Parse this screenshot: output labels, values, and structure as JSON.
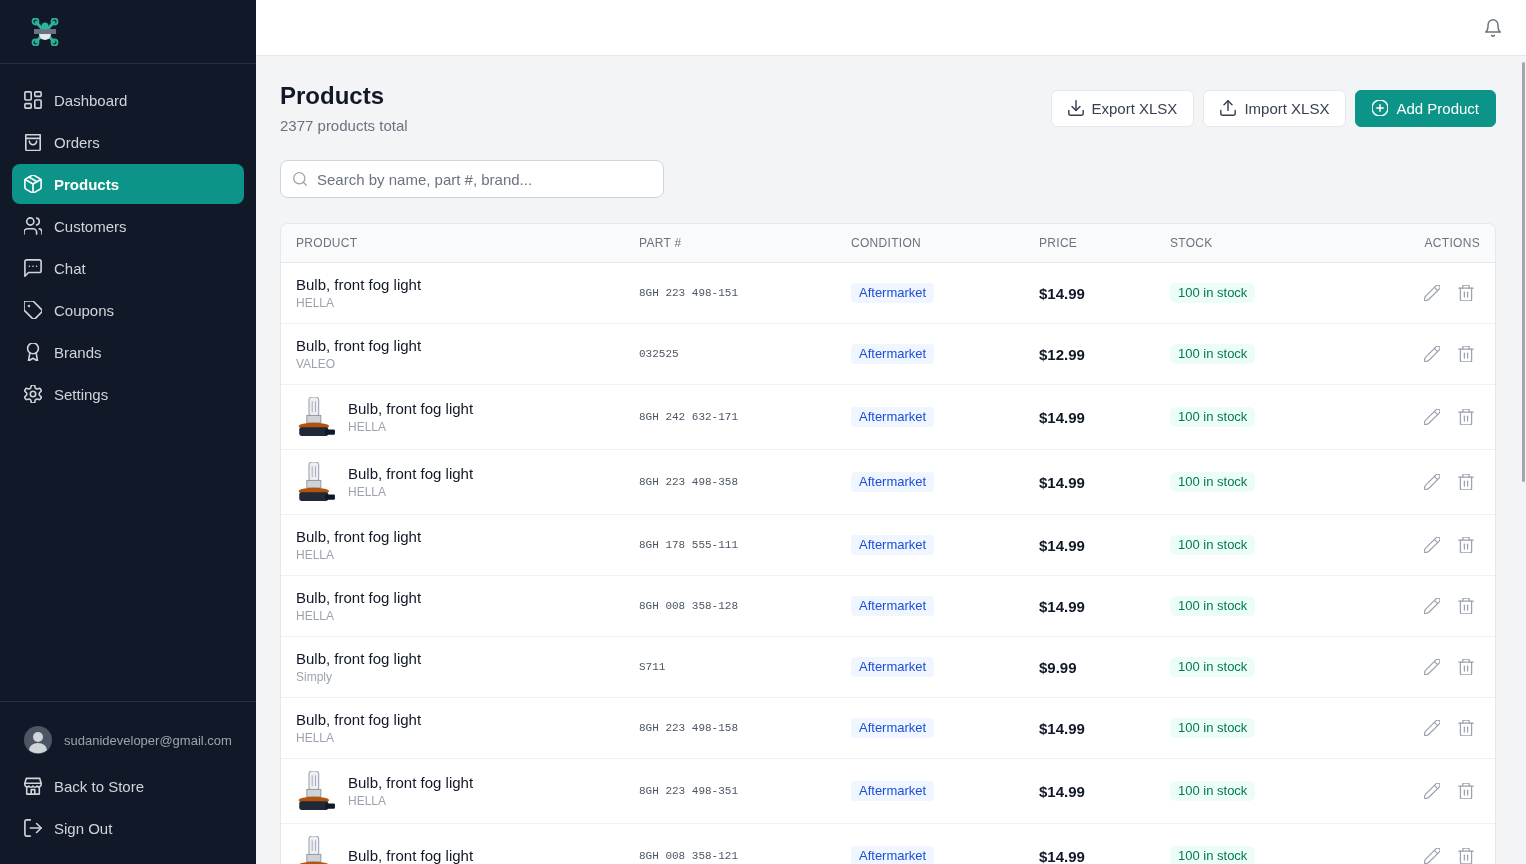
{
  "sidebar": {
    "nav": [
      {
        "label": "Dashboard",
        "selected": false
      },
      {
        "label": "Orders",
        "selected": false
      },
      {
        "label": "Products",
        "selected": true
      },
      {
        "label": "Customers",
        "selected": false
      },
      {
        "label": "Chat",
        "selected": false
      },
      {
        "label": "Coupons",
        "selected": false
      },
      {
        "label": "Brands",
        "selected": false
      },
      {
        "label": "Settings",
        "selected": false
      }
    ],
    "account": {
      "email": "sudanideveloper@gmail.com"
    },
    "links": [
      "Back to Store",
      "Sign Out"
    ]
  },
  "page": {
    "title": "Products",
    "subtitle": "2377 products total",
    "buttons": [
      {
        "label": "Export XLSX",
        "primary": false
      },
      {
        "label": "Import XLSX",
        "primary": false
      },
      {
        "label": "Add Product",
        "primary": true
      }
    ]
  },
  "search": {
    "placeholder": "Search by name, part #, brand..."
  },
  "table": {
    "columns": [
      "PRODUCT",
      "PART #",
      "CONDITION",
      "PRICE",
      "STOCK",
      "ACTIONS"
    ],
    "rows": [
      {
        "name": "Bulb, front fog light",
        "brand": "HELLA",
        "photo": false,
        "part_no": "8GH 223 498-151",
        "condition": "Aftermarket",
        "price": "$14.99",
        "stock": "100 in stock"
      },
      {
        "name": "Bulb, front fog light",
        "brand": "VALEO",
        "photo": false,
        "part_no": "032525",
        "condition": "Aftermarket",
        "price": "$12.99",
        "stock": "100 in stock"
      },
      {
        "name": "Bulb, front fog light",
        "brand": "HELLA",
        "photo": true,
        "part_no": "8GH 242 632-171",
        "condition": "Aftermarket",
        "price": "$14.99",
        "stock": "100 in stock"
      },
      {
        "name": "Bulb, front fog light",
        "brand": "HELLA",
        "photo": true,
        "part_no": "8GH 223 498-358",
        "condition": "Aftermarket",
        "price": "$14.99",
        "stock": "100 in stock"
      },
      {
        "name": "Bulb, front fog light",
        "brand": "HELLA",
        "photo": false,
        "part_no": "8GH 178 555-111",
        "condition": "Aftermarket",
        "price": "$14.99",
        "stock": "100 in stock"
      },
      {
        "name": "Bulb, front fog light",
        "brand": "HELLA",
        "photo": false,
        "part_no": "8GH 008 358-128",
        "condition": "Aftermarket",
        "price": "$14.99",
        "stock": "100 in stock"
      },
      {
        "name": "Bulb, front fog light",
        "brand": "Simply",
        "photo": false,
        "part_no": "S711",
        "condition": "Aftermarket",
        "price": "$9.99",
        "stock": "100 in stock"
      },
      {
        "name": "Bulb, front fog light",
        "brand": "HELLA",
        "photo": false,
        "part_no": "8GH 223 498-158",
        "condition": "Aftermarket",
        "price": "$14.99",
        "stock": "100 in stock"
      },
      {
        "name": "Bulb, front fog light",
        "brand": "HELLA",
        "photo": true,
        "part_no": "8GH 223 498-351",
        "condition": "Aftermarket",
        "price": "$14.99",
        "stock": "100 in stock"
      },
      {
        "name": "Bulb, front fog light",
        "photo": true,
        "part_no": "8GH 008 358-121",
        "condition": "Aftermarket",
        "price": "$14.99",
        "stock": "100 in stock"
      }
    ]
  }
}
